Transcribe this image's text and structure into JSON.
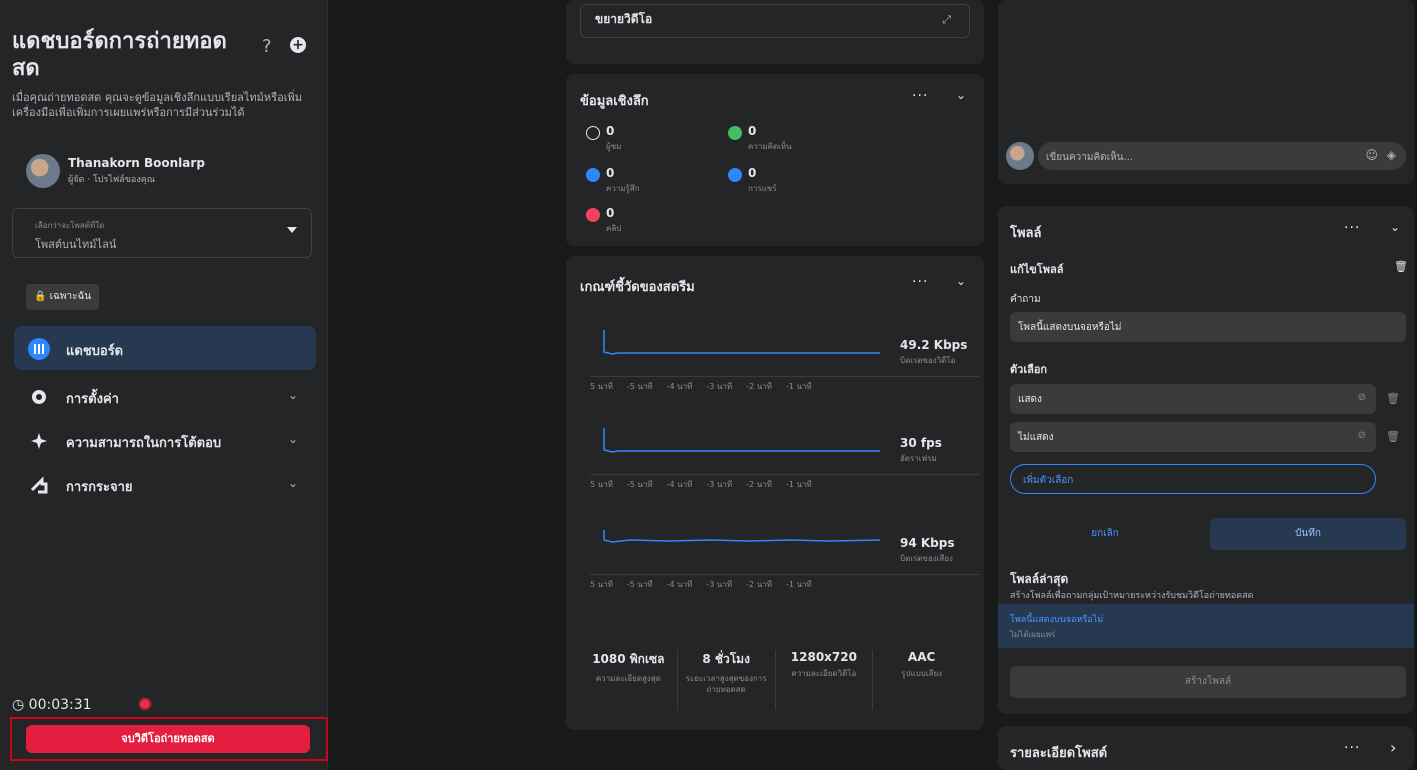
{
  "sidebar": {
    "title": "แดชบอร์ดการถ่ายทอดสด",
    "help_glyph": "?",
    "add_glyph": "+",
    "description": "เมื่อคุณถ่ายทอดสด คุณจะดูข้อมูลเชิงลึกแบบเรียลไทม์หรือเพิ่มเครื่องมือเพื่อเพิ่มการเผยแพร่หรือการมีส่วนร่วมได้",
    "host": {
      "name": "Thanakorn Boonlarp",
      "role": "ผู้จัด · โปรไฟล์ของคุณ"
    },
    "post_select": {
      "label": "เลือกว่าจะโพสต์ที่ใด",
      "value": "โพสต์บนไทม์ไลน์"
    },
    "privacy": "🔒 เฉพาะฉัน",
    "nav": [
      {
        "label": "แดชบอร์ด",
        "icon": "dashboard-icon",
        "color": "#2d88ff"
      },
      {
        "label": "การตั้งค่า",
        "icon": "gear-icon",
        "color": "#e4e6eb"
      },
      {
        "label": "ความสามารถในการโต้ตอบ",
        "icon": "sparkle-icon",
        "color": "#e4e6eb"
      },
      {
        "label": "การกระจาย",
        "icon": "share-icon",
        "color": "#e4e6eb"
      }
    ],
    "timer": "00:03:31",
    "end_button": "จบวิดีโอถ่ายทอดสด"
  },
  "video_panel": {
    "label": "ขยายวิดีโอ"
  },
  "insights": {
    "title": "ข้อมูลเชิงลึก",
    "metrics": [
      {
        "value": "0",
        "label": "ผู้ชม",
        "icon": "eye-icon",
        "color": "#e4e6eb"
      },
      {
        "value": "0",
        "label": "ความคิดเห็น",
        "icon": "comment-icon",
        "color": "#45bd62"
      },
      {
        "value": "0",
        "label": "ความรู้สึก",
        "icon": "like-icon",
        "color": "#2d88ff"
      },
      {
        "value": "0",
        "label": "การแชร์",
        "icon": "share-icon",
        "color": "#2d88ff"
      },
      {
        "value": "0",
        "label": "คลิป",
        "icon": "clip-icon",
        "color": "#f3425f"
      }
    ]
  },
  "stream_metrics": {
    "title": "เกณฑ์ชี้วัดของสตรีม",
    "graphs": [
      {
        "value": "49.2 Kbps",
        "label": "บิตเรตของวิดีโอ",
        "ticks": [
          "5 นาที",
          "-5 นาที",
          "-4 นาที",
          "-3 นาที",
          "-2 นาที",
          "-1 นาที"
        ]
      },
      {
        "value": "30 fps",
        "label": "อัตราเฟรม",
        "ticks": [
          "5 นาที",
          "-5 นาที",
          "-4 นาที",
          "-3 นาที",
          "-2 นาที",
          "-1 นาที"
        ]
      },
      {
        "value": "94 Kbps",
        "label": "บิตเรตของเสียง",
        "ticks": [
          "5 นาที",
          "-5 นาที",
          "-4 นาที",
          "-3 นาที",
          "-2 นาที",
          "-1 นาที"
        ]
      }
    ],
    "specs": [
      {
        "value": "1080 พิกเซล",
        "label": "ความละเอียดสูงสุด"
      },
      {
        "value": "8 ชั่วโมง",
        "label": "ระยะเวลาสูงสุดของการถ่ายทอดสด"
      },
      {
        "value": "1280x720",
        "label": "ความละเอียดวิดีโอ"
      },
      {
        "value": "AAC",
        "label": "รูปแบบเสียง"
      }
    ]
  },
  "comment": {
    "placeholder": "เขียนความคิดเห็น..."
  },
  "poll": {
    "title": "โพลล์",
    "edit_title": "แก้ไขโพลล์",
    "question_label": "คำถาม",
    "question_value": "โพลนี้แสดงบนจอหรือไม่",
    "options_label": "ตัวเลือก",
    "options": [
      "แสดง",
      "ไม่แสดง"
    ],
    "add_option": "เพิ่มตัวเลือก",
    "cancel": "ยกเลิก",
    "save": "บันทึก",
    "recent_title": "โพลล์ล่าสุด",
    "recent_desc": "สร้างโพลล์เพื่อถามกลุ่มเป้าหมายระหว่างรับชมวิดีโอถ่ายทอดสด",
    "recent_question": "โพลนี้แสดงบนจอหรือไม่",
    "recent_status": "ไม่ได้เผยแพร่",
    "create": "สร้างโพลล์"
  },
  "detail": {
    "title": "รายละเอียดโพสต์"
  }
}
